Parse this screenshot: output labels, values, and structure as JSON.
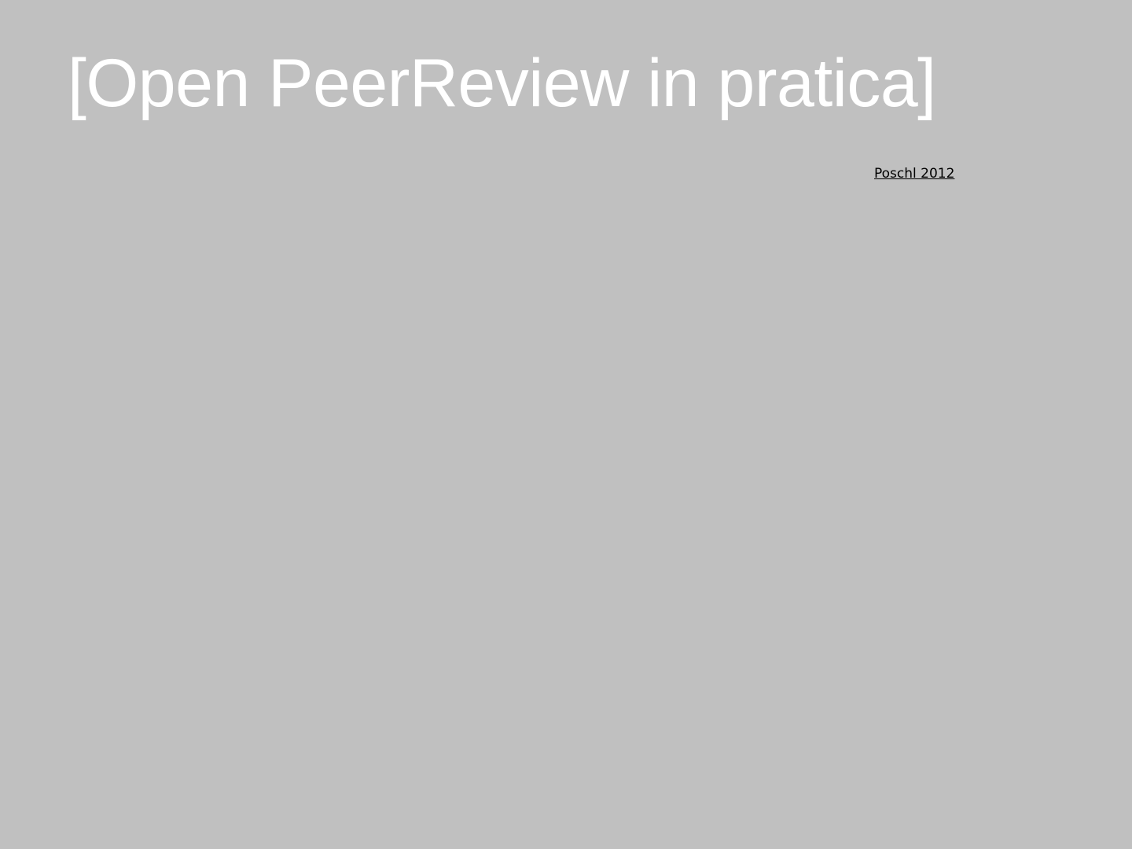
{
  "slide": {
    "title": "[Open PeerReview in pratica]",
    "citation_link": "Poschl 2012"
  },
  "colors": {
    "background": "#c0c0c0",
    "title_text": "#ffffff",
    "link_text": "#000000"
  }
}
